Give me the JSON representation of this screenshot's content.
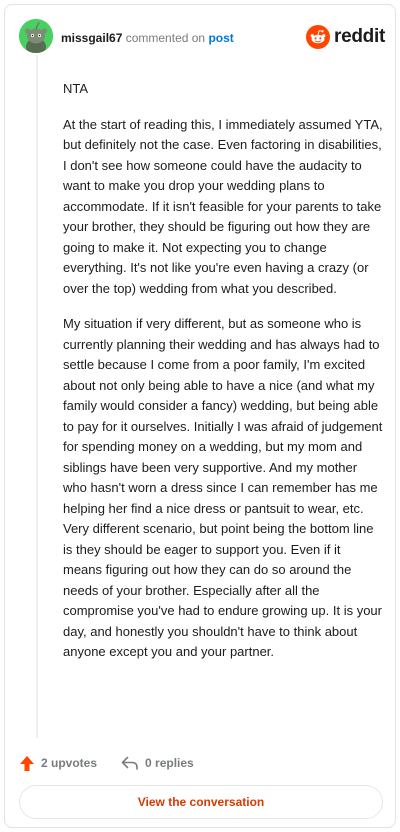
{
  "header": {
    "username": "missgail67",
    "commented_text": "commented on",
    "post_link": "post",
    "brand": "reddit",
    "avatar_icon": "snoo-avatar-icon",
    "brand_color": "#ff4500"
  },
  "comment": {
    "paragraphs": [
      "NTA",
      "At the start of reading this, I immediately assumed YTA, but definitely not the case. Even factoring in disabilities, I don't see how someone could have the audacity to want to make you drop your wedding plans to accommodate. If it isn't feasible for your parents to take your brother, they should be figuring out how they are going to make it. Not expecting you to change everything. It's not like you're even having a crazy (or over the top) wedding from what you described.",
      "My situation if very different, but as someone who is currently planning their wedding and has always had to settle because I come from a poor family, I'm excited about not only being able to have a nice (and what my family would consider a fancy) wedding, but being able to pay for it ourselves. Initially I was afraid of judgement for spending money on a wedding, but my mom and siblings have been very supportive. And my mother who hasn't worn a dress since I can remember has me helping her find a nice dress or pantsuit to wear, etc. Very different scenario, but point being the bottom line is they should be eager to support you. Even if it means figuring out how they can do so around the needs of your brother. Especially after all the compromise you've had to endure growing up. It is your day, and honestly you shouldn't have to think about anyone except you and your partner."
    ]
  },
  "actions": {
    "upvotes": "2 upvotes",
    "replies": "0 replies",
    "upvote_color": "#ff4500"
  },
  "cta": {
    "label": "View the conversation",
    "color": "#d93a00"
  }
}
